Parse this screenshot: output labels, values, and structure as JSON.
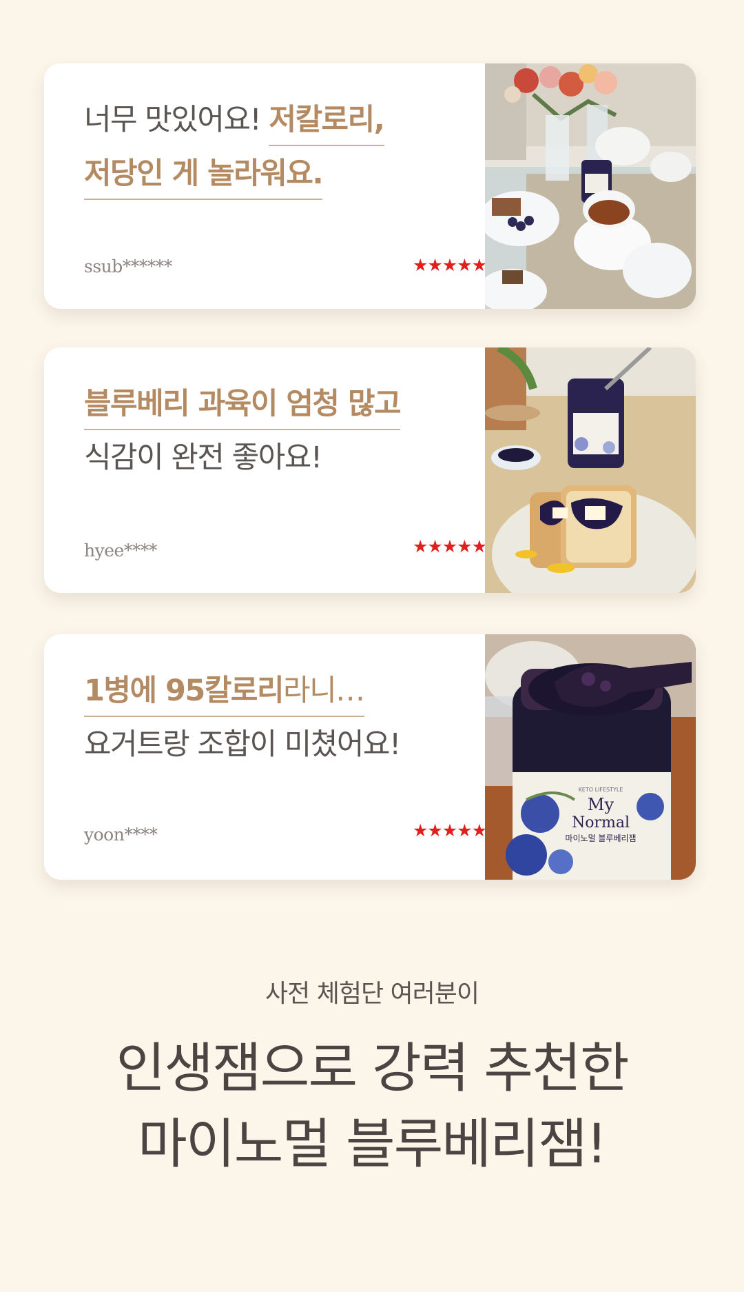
{
  "reviews": [
    {
      "line1_plain": "너무 맛있어요! ",
      "line1_accent": "저칼로리,",
      "line2_accent": "저당인 게 놀라워요.",
      "reviewer": "ssub******",
      "stars": "★★★★★",
      "photo_icon": "tea-table-photo"
    },
    {
      "line1_accent": "블루베리 과육이 엄청 많고",
      "line2_plain": "식감이 완전 좋아요!",
      "reviewer": "hyee****",
      "stars": "★★★★★",
      "photo_icon": "toast-jam-photo"
    },
    {
      "line1_accent": "1병에 95칼로리",
      "line1_soft": "라니…",
      "line2_plain": "요거트랑 조합이 미쳤어요!",
      "reviewer": "yoon****",
      "stars": "★★★★★",
      "photo_icon": "jam-jar-photo"
    }
  ],
  "photo_labels": {
    "brand_top": "KETO LIFESTYLE",
    "brand_my": "My",
    "brand_normal": "Normal",
    "product": "마이노멀 블루베리잼"
  },
  "footer": {
    "subtitle": "사전 체험단 여러분이",
    "title_line1": "인생잼으로 강력 추천한",
    "title_line2": "마이노멀 블루베리잼!"
  },
  "colors": {
    "background": "#fbf5ea",
    "accent": "#b48a62",
    "star": "#e11f1f",
    "text": "#5a5552"
  }
}
